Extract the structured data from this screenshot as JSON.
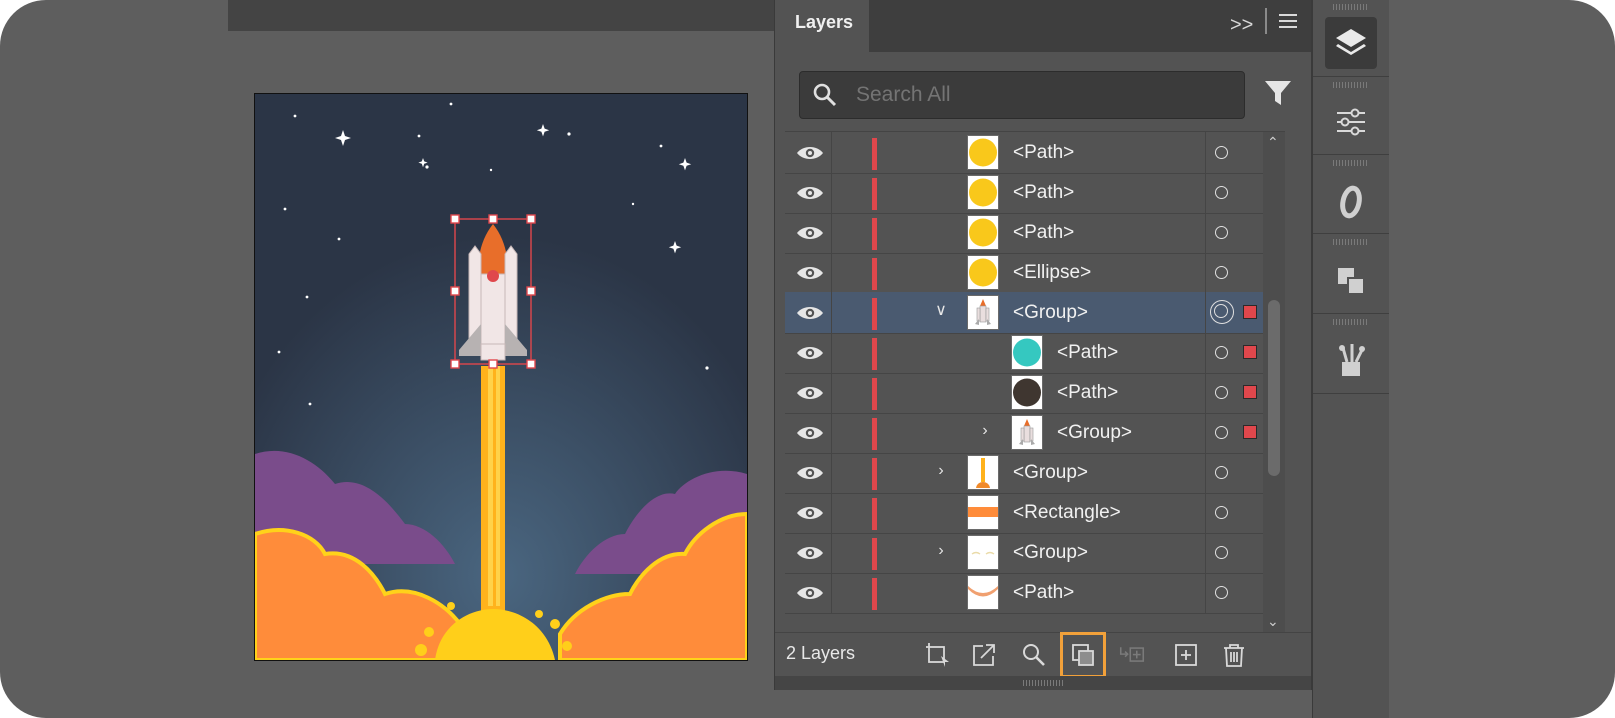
{
  "panel": {
    "tab_label": "Layers",
    "expand_glyph": ">>",
    "search_placeholder": "Search All",
    "footer_label": "2 Layers"
  },
  "colors": {
    "sky": "#2d3b4e",
    "selection_red": "#e0474c",
    "flame_yellow": "#f9c81b",
    "cloud_orange": "#ff8c3a",
    "cloud_purple": "#7a4c8b",
    "highlight_orange": "#f2a13a"
  },
  "layers": [
    {
      "name": "<Path>",
      "thumb": "yellow-circle",
      "indent": 0,
      "chevron": "",
      "target": "single",
      "selected_square": false,
      "row_selected": false
    },
    {
      "name": "<Path>",
      "thumb": "yellow-circle",
      "indent": 0,
      "chevron": "",
      "target": "single",
      "selected_square": false,
      "row_selected": false
    },
    {
      "name": "<Path>",
      "thumb": "yellow-circle",
      "indent": 0,
      "chevron": "",
      "target": "single",
      "selected_square": false,
      "row_selected": false
    },
    {
      "name": "<Ellipse>",
      "thumb": "yellow-circle",
      "indent": 0,
      "chevron": "",
      "target": "single",
      "selected_square": false,
      "row_selected": false
    },
    {
      "name": "<Group>",
      "thumb": "rocket",
      "indent": 0,
      "chevron": "down",
      "target": "double",
      "selected_square": true,
      "row_selected": true
    },
    {
      "name": "<Path>",
      "thumb": "teal-circle",
      "indent": 1,
      "chevron": "",
      "target": "single",
      "selected_square": true,
      "row_selected": false
    },
    {
      "name": "<Path>",
      "thumb": "dark-circle",
      "indent": 1,
      "chevron": "",
      "target": "single",
      "selected_square": true,
      "row_selected": false
    },
    {
      "name": "<Group>",
      "thumb": "rocket",
      "indent": 1,
      "chevron": "right",
      "target": "single",
      "selected_square": true,
      "row_selected": false
    },
    {
      "name": "<Group>",
      "thumb": "flame",
      "indent": 0,
      "chevron": "right",
      "target": "single",
      "selected_square": false,
      "row_selected": false
    },
    {
      "name": "<Rectangle>",
      "thumb": "orange-bar",
      "indent": 0,
      "chevron": "",
      "target": "single",
      "selected_square": false,
      "row_selected": false
    },
    {
      "name": "<Group>",
      "thumb": "faint",
      "indent": 0,
      "chevron": "right",
      "target": "single",
      "selected_square": false,
      "row_selected": false
    },
    {
      "name": "<Path>",
      "thumb": "orange-arc",
      "indent": 0,
      "chevron": "",
      "target": "single",
      "selected_square": false,
      "row_selected": false
    }
  ],
  "footer_icons": [
    "collect-export-icon",
    "export-icon",
    "locate-object-icon",
    "make-clipping-mask-icon",
    "create-sublayer-icon",
    "create-new-layer-icon",
    "delete-icon"
  ],
  "right_toolbar": [
    "layers-icon",
    "properties-icon",
    "glyphs-icon",
    "pathfinder-icon",
    "libraries-icon"
  ]
}
